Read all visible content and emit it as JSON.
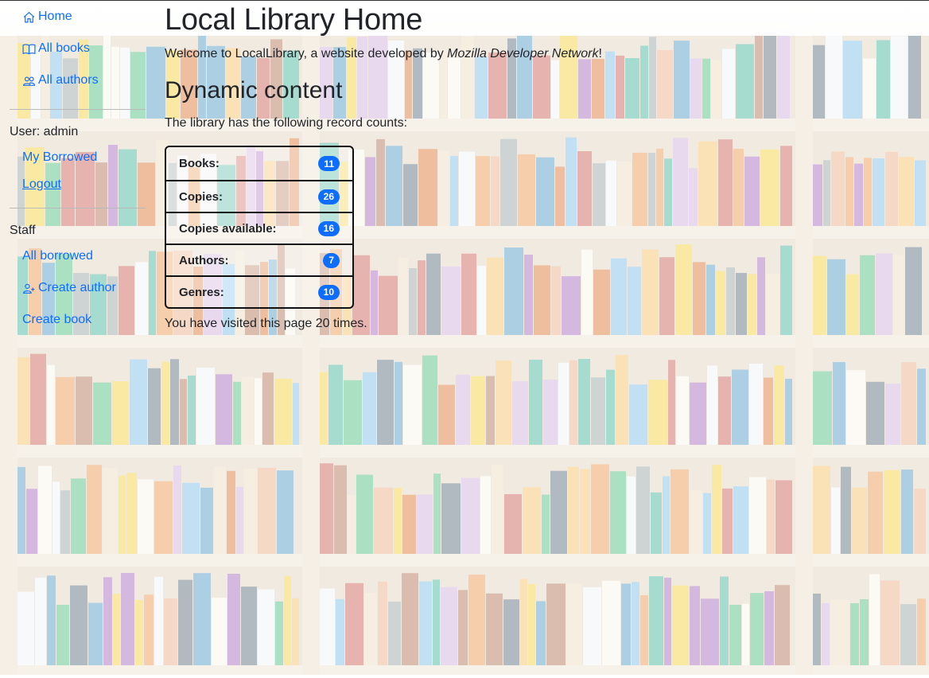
{
  "sidebar": {
    "nav": [
      {
        "label": "Home",
        "icon": "home-icon"
      },
      {
        "label": "All books",
        "icon": "book-icon"
      },
      {
        "label": "All authors",
        "icon": "people-icon"
      }
    ],
    "user_label": "User: admin",
    "user_links": [
      {
        "label": "My Borrowed"
      },
      {
        "label": "Logout"
      }
    ],
    "staff_label": "Staff",
    "staff_links": [
      {
        "label": "All borrowed"
      },
      {
        "label": "Create author",
        "icon": "person-add-icon"
      },
      {
        "label": "Create book"
      }
    ]
  },
  "main": {
    "title": "Local Library Home",
    "welcome_prefix": "Welcome to LocalLibrary, a website developed by ",
    "welcome_emphasis": "Mozilla Developer Network",
    "welcome_suffix": "!",
    "section_title": "Dynamic content",
    "counts_intro": "The library has the following record counts:",
    "counts": [
      {
        "label": "Books:",
        "value": "11"
      },
      {
        "label": "Copies:",
        "value": "26"
      },
      {
        "label": "Copies available:",
        "value": "16"
      },
      {
        "label": "Authors:",
        "value": "7"
      },
      {
        "label": "Genres:",
        "value": "10"
      }
    ],
    "visits_text": "You have visited this page 20 times."
  },
  "colors": {
    "link": "#0d6efd",
    "badge": "#0d6efd",
    "text": "#212529"
  }
}
